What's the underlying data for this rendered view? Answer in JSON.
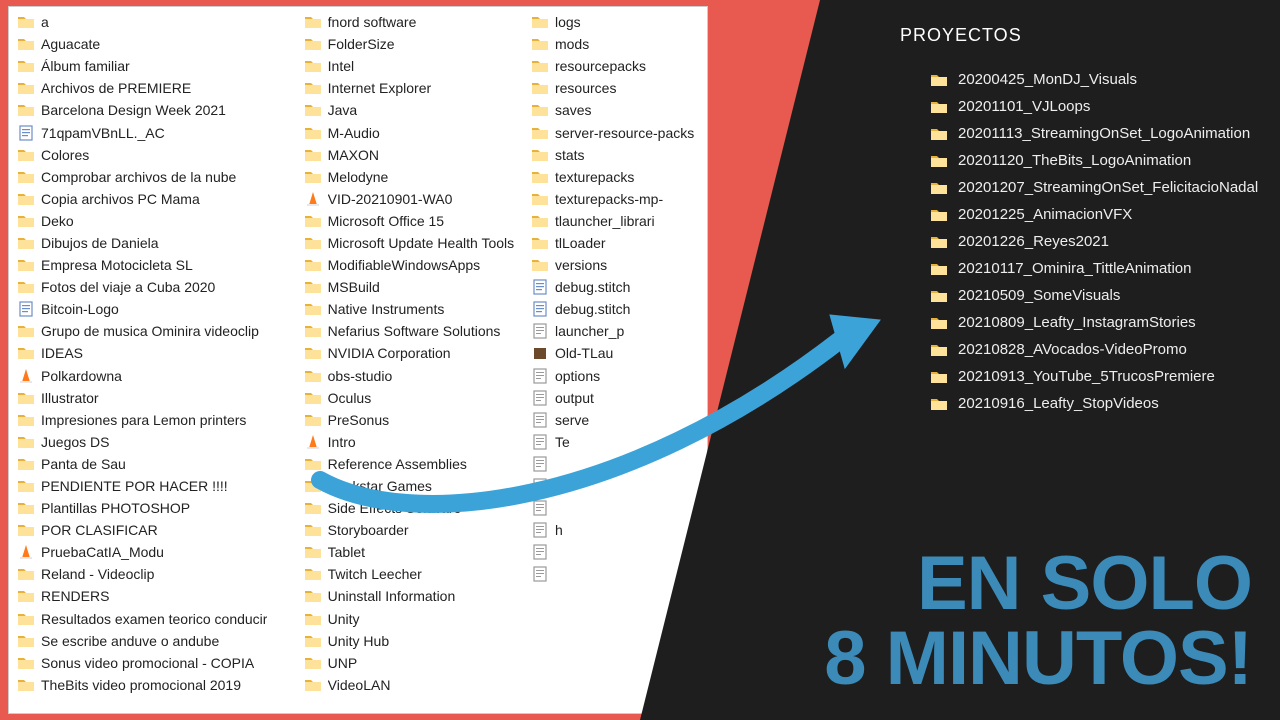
{
  "left": {
    "col1": [
      {
        "icon": "folder",
        "label": "a"
      },
      {
        "icon": "folder",
        "label": "Aguacate"
      },
      {
        "icon": "folder",
        "label": "Álbum familiar"
      },
      {
        "icon": "folder",
        "label": "Archivos de PREMIERE"
      },
      {
        "icon": "folder",
        "label": "Barcelona Design Week 2021"
      },
      {
        "icon": "doc",
        "label": "71qpamVBnLL._AC"
      },
      {
        "icon": "folder",
        "label": "Colores"
      },
      {
        "icon": "folder",
        "label": "Comprobar archivos de la nube"
      },
      {
        "icon": "folder",
        "label": "Copia archivos PC Mama"
      },
      {
        "icon": "folder",
        "label": "Deko"
      },
      {
        "icon": "folder",
        "label": "Dibujos de Daniela"
      },
      {
        "icon": "folder",
        "label": "Empresa Motocicleta SL"
      },
      {
        "icon": "folder",
        "label": "Fotos del viaje a Cuba 2020"
      },
      {
        "icon": "doc",
        "label": "Bitcoin-Logo"
      },
      {
        "icon": "folder",
        "label": "Grupo de musica Ominira videoclip"
      },
      {
        "icon": "folder",
        "label": "IDEAS"
      },
      {
        "icon": "vlc",
        "label": "Polkardowna"
      },
      {
        "icon": "folder",
        "label": "Illustrator"
      },
      {
        "icon": "folder",
        "label": "Impresiones para Lemon printers"
      },
      {
        "icon": "folder",
        "label": "Juegos DS"
      },
      {
        "icon": "folder",
        "label": "Panta de Sau"
      },
      {
        "icon": "folder",
        "label": "PENDIENTE POR HACER !!!!"
      },
      {
        "icon": "folder",
        "label": "Plantillas PHOTOSHOP"
      },
      {
        "icon": "folder",
        "label": "POR CLASIFICAR"
      },
      {
        "icon": "vlc",
        "label": "PruebaCatIA_Modu"
      },
      {
        "icon": "folder",
        "label": "Reland - Videoclip"
      },
      {
        "icon": "folder",
        "label": "RENDERS"
      },
      {
        "icon": "folder",
        "label": "Resultados examen teorico conducir"
      },
      {
        "icon": "folder",
        "label": "Se escribe anduve o andube"
      },
      {
        "icon": "folder",
        "label": "Sonus video promocional - COPIA"
      },
      {
        "icon": "folder",
        "label": "TheBits video promocional 2019"
      }
    ],
    "col2": [
      {
        "icon": "folder",
        "label": "fnord software"
      },
      {
        "icon": "folder",
        "label": "FolderSize"
      },
      {
        "icon": "folder",
        "label": "Intel"
      },
      {
        "icon": "folder",
        "label": "Internet Explorer"
      },
      {
        "icon": "folder",
        "label": "Java"
      },
      {
        "icon": "folder",
        "label": "M-Audio"
      },
      {
        "icon": "folder",
        "label": "MAXON"
      },
      {
        "icon": "folder",
        "label": "Melodyne"
      },
      {
        "icon": "vlc",
        "label": "VID-20210901-WA0"
      },
      {
        "icon": "folder",
        "label": "Microsoft Office 15"
      },
      {
        "icon": "folder",
        "label": "Microsoft Update Health Tools"
      },
      {
        "icon": "folder",
        "label": "ModifiableWindowsApps"
      },
      {
        "icon": "folder",
        "label": "MSBuild"
      },
      {
        "icon": "folder",
        "label": "Native Instruments"
      },
      {
        "icon": "folder",
        "label": "Nefarius Software Solutions"
      },
      {
        "icon": "folder",
        "label": "NVIDIA Corporation"
      },
      {
        "icon": "folder",
        "label": "obs-studio"
      },
      {
        "icon": "folder",
        "label": "Oculus"
      },
      {
        "icon": "folder",
        "label": "PreSonus"
      },
      {
        "icon": "vlc",
        "label": "Intro"
      },
      {
        "icon": "folder",
        "label": "Reference Assemblies"
      },
      {
        "icon": "folder",
        "label": "Rockstar Games"
      },
      {
        "icon": "folder",
        "label": "Side Effects Software"
      },
      {
        "icon": "folder",
        "label": "Storyboarder"
      },
      {
        "icon": "folder",
        "label": "Tablet"
      },
      {
        "icon": "folder",
        "label": "Twitch Leecher"
      },
      {
        "icon": "folder",
        "label": "Uninstall Information"
      },
      {
        "icon": "folder",
        "label": "Unity"
      },
      {
        "icon": "folder",
        "label": "Unity Hub"
      },
      {
        "icon": "folder",
        "label": "UNP"
      },
      {
        "icon": "folder",
        "label": "VideoLAN"
      }
    ],
    "col3": [
      {
        "icon": "folder",
        "label": "logs"
      },
      {
        "icon": "folder",
        "label": "mods"
      },
      {
        "icon": "folder",
        "label": "resourcepacks"
      },
      {
        "icon": "folder",
        "label": "resources"
      },
      {
        "icon": "folder",
        "label": "saves"
      },
      {
        "icon": "folder",
        "label": "server-resource-packs"
      },
      {
        "icon": "folder",
        "label": "stats"
      },
      {
        "icon": "folder",
        "label": "texturepacks"
      },
      {
        "icon": "folder",
        "label": "texturepacks-mp-"
      },
      {
        "icon": "folder",
        "label": "tlauncher_librari"
      },
      {
        "icon": "folder",
        "label": "tlLoader"
      },
      {
        "icon": "folder",
        "label": "versions"
      },
      {
        "icon": "doc",
        "label": "debug.stitch"
      },
      {
        "icon": "doc",
        "label": "debug.stitch"
      },
      {
        "icon": "txt",
        "label": "launcher_p"
      },
      {
        "icon": "box",
        "label": "Old-TLau"
      },
      {
        "icon": "txt",
        "label": "options"
      },
      {
        "icon": "txt",
        "label": "output"
      },
      {
        "icon": "txt",
        "label": "serve"
      },
      {
        "icon": "txt",
        "label": "Te"
      },
      {
        "icon": "txt",
        "label": ""
      },
      {
        "icon": "txt",
        "label": "t"
      },
      {
        "icon": "txt",
        "label": ""
      },
      {
        "icon": "txt",
        "label": "h"
      },
      {
        "icon": "txt",
        "label": ""
      },
      {
        "icon": "txt",
        "label": ""
      }
    ]
  },
  "right": {
    "title": "PROYECTOS",
    "items": [
      "20200425_MonDJ_Visuals",
      "20201101_VJLoops",
      "20201113_StreamingOnSet_LogoAnimation",
      "20201120_TheBits_LogoAnimation",
      "20201207_StreamingOnSet_FelicitacioNadal",
      "20201225_AnimacionVFX",
      "20201226_Reyes2021",
      "20210117_Ominira_TittleAnimation",
      "20210509_SomeVisuals",
      "20210809_Leafty_InstagramStories",
      "20210828_AVocados-VideoPromo",
      "20210913_YouTube_5TrucosPremiere",
      "20210916_Leafty_StopVideos"
    ]
  },
  "headline": {
    "line1": "EN SOLO",
    "line2": "8 MINUTOS!"
  }
}
